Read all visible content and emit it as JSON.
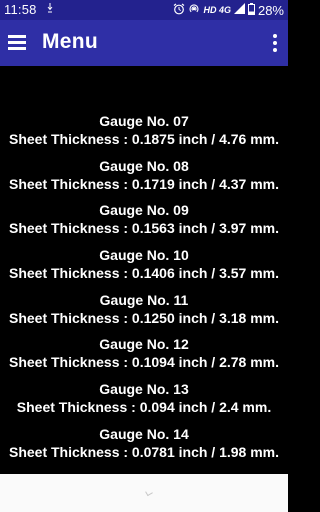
{
  "status_bar": {
    "time": "11:58",
    "network": "HD 4G",
    "battery": "28%"
  },
  "app_bar": {
    "title": "Menu",
    "menu_icon": "hamburger-menu-icon",
    "overflow_icon": "more-vertical-icon"
  },
  "gauges": [
    {
      "name": "Gauge No. 07",
      "thickness": "Sheet Thickness : 0.1875 inch / 4.76 mm."
    },
    {
      "name": "Gauge No. 08",
      "thickness": "Sheet Thickness : 0.1719 inch / 4.37 mm."
    },
    {
      "name": "Gauge No. 09",
      "thickness": "Sheet Thickness : 0.1563 inch / 3.97 mm."
    },
    {
      "name": "Gauge No. 10",
      "thickness": "Sheet Thickness : 0.1406 inch / 3.57 mm."
    },
    {
      "name": "Gauge No. 11",
      "thickness": "Sheet Thickness : 0.1250 inch / 3.18 mm."
    },
    {
      "name": "Gauge No. 12",
      "thickness": "Sheet Thickness : 0.1094 inch / 2.78 mm."
    },
    {
      "name": "Gauge No. 13",
      "thickness": "Sheet Thickness : 0.094 inch / 2.4 mm."
    },
    {
      "name": "Gauge No. 14",
      "thickness": "Sheet Thickness : 0.0781 inch / 1.98 mm."
    }
  ],
  "colors": {
    "status_bar": "#23228e",
    "app_bar": "#2f2fa6",
    "content_background": "#000000",
    "text": "#ffffff"
  }
}
